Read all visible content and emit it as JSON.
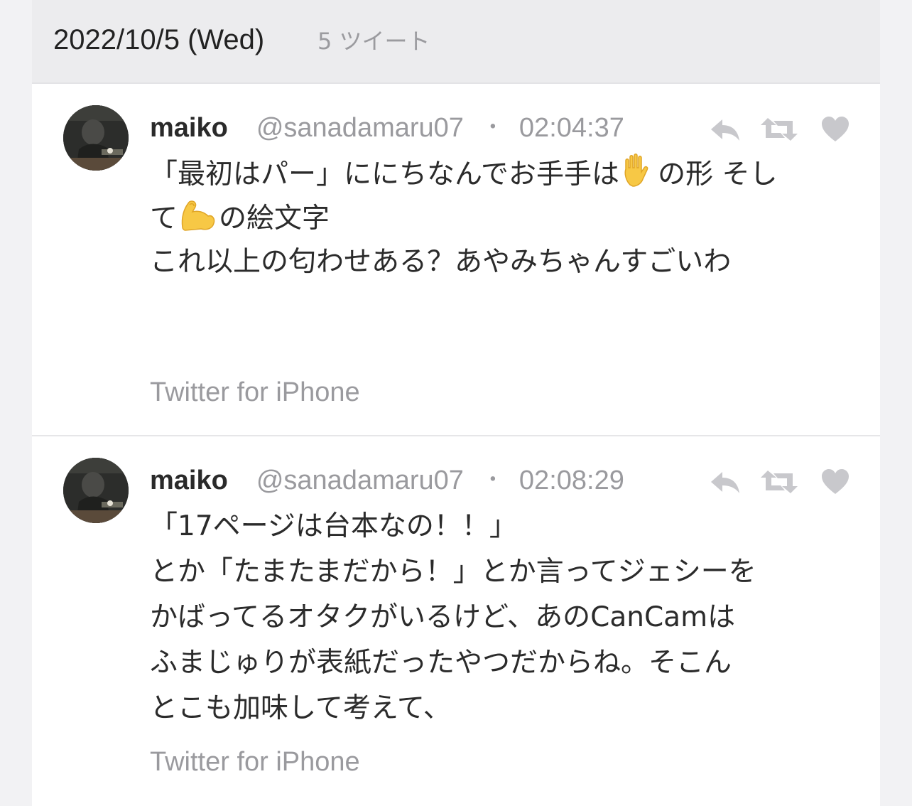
{
  "day_header": {
    "date": "2022/10/5 (Wed)",
    "count": "5 ツイート"
  },
  "tweets": [
    {
      "name": "maiko",
      "handle": "@sanadamaru07",
      "separator": "・",
      "time": "02:04:37",
      "lines": [
        {
          "before": "「最初はパー」ににちなんでお手手は",
          "emoji": "raised-hand",
          "after": "の形 そし"
        },
        {
          "before": "て",
          "emoji": "flexed-biceps",
          "after": "の絵文字"
        },
        {
          "before": "これ以上の匂わせある？あやみちゃんすごいわ",
          "emoji": "",
          "after": ""
        }
      ],
      "source": "Twitter for iPhone"
    },
    {
      "name": "maiko",
      "handle": "@sanadamaru07",
      "separator": "・",
      "time": "02:08:29",
      "lines": [
        {
          "before": "「17ページは台本なの！！」",
          "emoji": "",
          "after": ""
        },
        {
          "before": "とか「たまたまだから！」とか言ってジェシーを",
          "emoji": "",
          "after": ""
        },
        {
          "before": "かばってるオタクがいるけど、あのCanCamは",
          "emoji": "",
          "after": ""
        },
        {
          "before": "ふまじゅりが表紙だったやつだからね。そこん",
          "emoji": "",
          "after": ""
        },
        {
          "before": "とこも加味して考えて、",
          "emoji": "",
          "after": ""
        }
      ],
      "source": "Twitter for iPhone"
    }
  ],
  "icons": {
    "reply": "reply-icon",
    "retweet": "retweet-icon",
    "like": "heart-icon",
    "emoji_1": "raised-hand-emoji",
    "emoji_2": "flexed-biceps-emoji"
  },
  "colors": {
    "background": "#f2f2f4",
    "header_bg": "#ececee",
    "card_bg": "#ffffff",
    "muted_text": "#9a9a9e",
    "body_text": "#2b2b2b",
    "icon_gray": "#c8c8cc"
  }
}
